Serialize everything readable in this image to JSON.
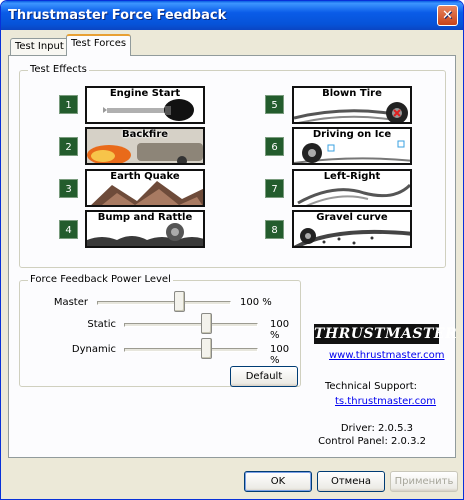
{
  "window": {
    "title": "Thrustmaster Force Feedback"
  },
  "tabs": [
    {
      "label": "Test Input"
    },
    {
      "label": "Test Forces"
    }
  ],
  "test_effects": {
    "title": "Test Effects",
    "items": [
      {
        "number": "1",
        "label": "Engine Start"
      },
      {
        "number": "2",
        "label": "Backfire"
      },
      {
        "number": "3",
        "label": "Earth Quake"
      },
      {
        "number": "4",
        "label": "Bump and Rattle"
      },
      {
        "number": "5",
        "label": "Blown Tire"
      },
      {
        "number": "6",
        "label": "Driving on Ice"
      },
      {
        "number": "7",
        "label": "Left-Right"
      },
      {
        "number": "8",
        "label": "Gravel curve"
      }
    ]
  },
  "power": {
    "title": "Force Feedback Power Level",
    "master": {
      "label": "Master",
      "value": 1.0,
      "text": "100 %"
    },
    "static": {
      "label": "Static",
      "value": 1.0,
      "text": "100 %"
    },
    "dynamic": {
      "label": "Dynamic",
      "value": 1.0,
      "text": "100 %"
    },
    "default_label": "Default"
  },
  "brand": {
    "logo_text": "THRUSTMASTER",
    "website": "www.thrustmaster.com",
    "support_label": "Technical Support:",
    "support_link": "ts.thrustmaster.com",
    "driver": "Driver: 2.0.5.3",
    "control_panel": "Control Panel: 2.0.3.2"
  },
  "buttons": {
    "ok": "OK",
    "cancel": "Отмена",
    "apply": "Применить"
  },
  "colors": {
    "number_badge": "#235c2d",
    "title_bar": "#0a5ce8",
    "link": "#0000ee"
  }
}
